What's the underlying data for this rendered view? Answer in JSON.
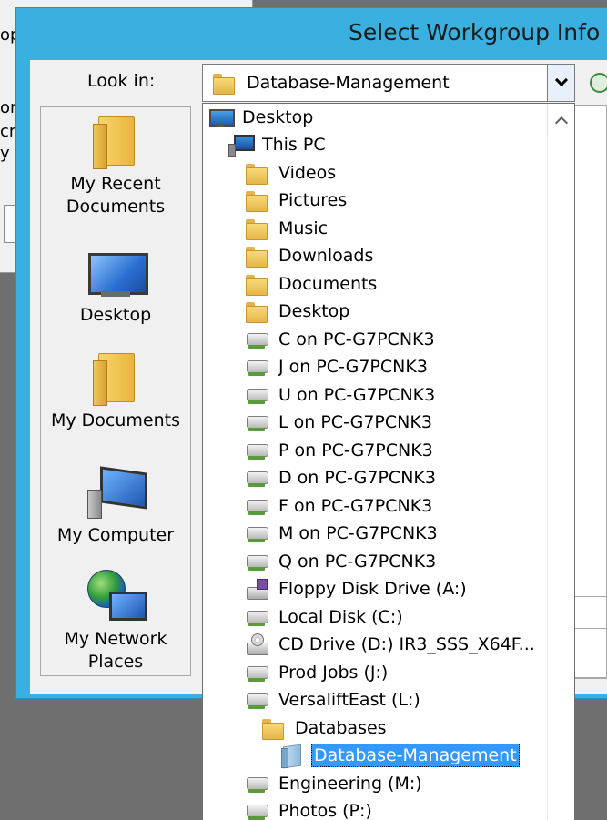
{
  "background_window": {
    "fragments": [
      "op",
      "or",
      "cr",
      "y c"
    ]
  },
  "dialog": {
    "title": "Select Workgroup Info"
  },
  "look_in": {
    "label": "Look in:",
    "selected": "Database-Management"
  },
  "places": [
    {
      "label": "My Recent\nDocuments",
      "icon": "recent-documents-folder-icon"
    },
    {
      "label": "Desktop",
      "icon": "desktop-monitor-icon"
    },
    {
      "label": "My Documents",
      "icon": "documents-folder-icon"
    },
    {
      "label": "My Computer",
      "icon": "computer-icon"
    },
    {
      "label": "My Network\nPlaces",
      "icon": "network-globe-icon"
    }
  ],
  "dropdown": {
    "items": [
      {
        "label": "Desktop",
        "icon": "monitor-icon",
        "level": 0
      },
      {
        "label": "This PC",
        "icon": "pc-icon",
        "level": 1
      },
      {
        "label": "Videos",
        "icon": "folder-icon",
        "level": 2
      },
      {
        "label": "Pictures",
        "icon": "folder-icon",
        "level": 2
      },
      {
        "label": "Music",
        "icon": "folder-icon",
        "level": 2
      },
      {
        "label": "Downloads",
        "icon": "folder-icon",
        "level": 2
      },
      {
        "label": "Documents",
        "icon": "folder-icon",
        "level": 2
      },
      {
        "label": "Desktop",
        "icon": "folder-icon",
        "level": 2
      },
      {
        "label": "C on PC-G7PCNK3",
        "icon": "network-drive-icon",
        "level": 2
      },
      {
        "label": "J on PC-G7PCNK3",
        "icon": "network-drive-icon",
        "level": 2
      },
      {
        "label": "U on PC-G7PCNK3",
        "icon": "network-drive-icon",
        "level": 2
      },
      {
        "label": "L on PC-G7PCNK3",
        "icon": "network-drive-icon",
        "level": 2
      },
      {
        "label": "P on PC-G7PCNK3",
        "icon": "network-drive-icon",
        "level": 2
      },
      {
        "label": "D on PC-G7PCNK3",
        "icon": "network-drive-icon",
        "level": 2
      },
      {
        "label": "F on PC-G7PCNK3",
        "icon": "network-drive-icon",
        "level": 2
      },
      {
        "label": "M on PC-G7PCNK3",
        "icon": "network-drive-icon",
        "level": 2
      },
      {
        "label": "Q on PC-G7PCNK3",
        "icon": "network-drive-icon",
        "level": 2
      },
      {
        "label": "Floppy Disk Drive (A:)",
        "icon": "floppy-drive-icon",
        "level": 2
      },
      {
        "label": "Local Disk (C:)",
        "icon": "local-disk-icon",
        "level": 2
      },
      {
        "label": "CD Drive (D:) IR3_SSS_X64F...",
        "icon": "cd-drive-icon",
        "level": 2
      },
      {
        "label": "Prod Jobs (J:)",
        "icon": "network-drive-icon",
        "level": 2
      },
      {
        "label": "VersaliftEast (L:)",
        "icon": "network-drive-icon",
        "level": 2
      },
      {
        "label": "Databases",
        "icon": "folder-icon",
        "level": 3
      },
      {
        "label": "Database-Management",
        "icon": "open-folder-icon",
        "level": 4,
        "selected": true
      },
      {
        "label": "Engineering (M:)",
        "icon": "network-drive-icon",
        "level": 2
      },
      {
        "label": "Photos (P:)",
        "icon": "network-drive-icon",
        "level": 2
      }
    ]
  }
}
